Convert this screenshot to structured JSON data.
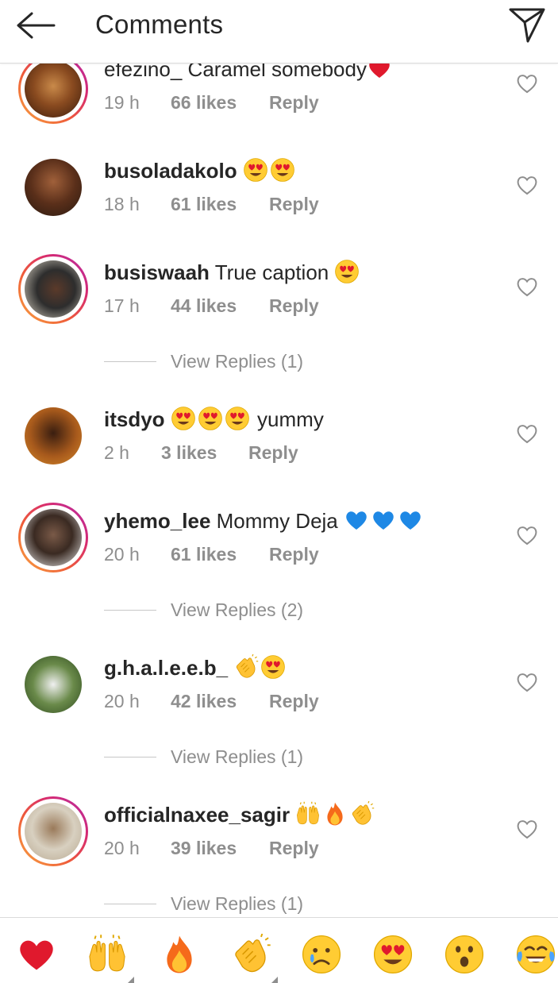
{
  "header": {
    "title": "Comments"
  },
  "comments": [
    {
      "username": "efezino_",
      "text": " Caramel somebody",
      "emoji": [
        "red-heart"
      ],
      "time": "19 h",
      "likes": "66 likes",
      "reply": "Reply",
      "view_replies": ""
    },
    {
      "username": "busoladakolo",
      "text": " ",
      "emoji": [
        "heart-eyes",
        "heart-eyes"
      ],
      "time": "18 h",
      "likes": "61 likes",
      "reply": "Reply",
      "view_replies": ""
    },
    {
      "username": "busiswaah",
      "text": " True caption ",
      "emoji": [
        "heart-eyes"
      ],
      "time": "17 h",
      "likes": "44 likes",
      "reply": "Reply",
      "view_replies": "View Replies (1)"
    },
    {
      "username": "itsdyo",
      "text": " ",
      "emoji": [
        "heart-eyes",
        "heart-eyes",
        "heart-eyes"
      ],
      "text_after": " yummy",
      "time": "2 h",
      "likes": "3 likes",
      "reply": "Reply",
      "view_replies": ""
    },
    {
      "username": "yhemo_lee",
      "text": " Mommy Deja ",
      "emoji": [
        "blue-heart",
        "blue-heart",
        "blue-heart"
      ],
      "time": "20 h",
      "likes": "61 likes",
      "reply": "Reply",
      "view_replies": "View Replies (2)"
    },
    {
      "username": "g.h.a.l.e.e.b_",
      "text": " ",
      "emoji": [
        "clapping-hands",
        "heart-eyes"
      ],
      "time": "20 h",
      "likes": "42 likes",
      "reply": "Reply",
      "view_replies": "View Replies (1)"
    },
    {
      "username": "officialnaxee_sagir",
      "text": " ",
      "emoji": [
        "raising-hands",
        "fire",
        "clapping-hands"
      ],
      "time": "20 h",
      "likes": "39 likes",
      "reply": "Reply",
      "view_replies": "View Replies (1)"
    }
  ],
  "emoji_bar": [
    "red-heart",
    "raising-hands",
    "fire",
    "clapping-hands",
    "crying-face",
    "heart-eyes",
    "surprised-face",
    "tears-of-joy"
  ],
  "colors": {
    "accent_ring_start": "#f9a640",
    "accent_ring_end": "#b22dab",
    "muted_text": "#8e8e8e",
    "heart_red": "#e0192d",
    "blue_heart": "#1e88e5"
  }
}
